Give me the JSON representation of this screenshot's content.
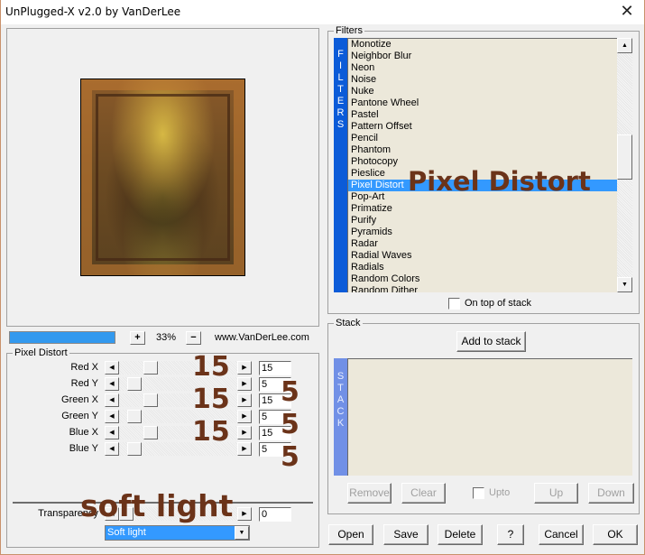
{
  "window": {
    "title": "UnPlugged-X v2.0 by VanDerLee",
    "close_glyph": "✕"
  },
  "preview": {
    "progress_percent": 100,
    "zoom_in_label": "+",
    "zoom_level": "33%",
    "zoom_out_label": "−",
    "website": "www.VanDerLee.com"
  },
  "params": {
    "group_label": "Pixel Distort",
    "sliders": [
      {
        "label": "Red X",
        "value": "15",
        "fraction": 0.15
      },
      {
        "label": "Red Y",
        "value": "5",
        "fraction": 0.05
      },
      {
        "label": "Green X",
        "value": "15",
        "fraction": 0.15
      },
      {
        "label": "Green Y",
        "value": "5",
        "fraction": 0.05
      },
      {
        "label": "Blue X",
        "value": "15",
        "fraction": 0.15
      },
      {
        "label": "Blue Y",
        "value": "5",
        "fraction": 0.05
      }
    ],
    "arrow_left": "◀",
    "arrow_right": "▶",
    "transparency": {
      "label": "Transparency",
      "value": "0",
      "fraction": 0.0
    },
    "blend_mode": {
      "selected": "Soft light",
      "arrow": "▼"
    }
  },
  "overlays": {
    "filter_name": "Pixel Distort",
    "slider_values": [
      "15",
      "5",
      "15",
      "5",
      "15",
      "5"
    ],
    "blend_mode": "soft light"
  },
  "filters": {
    "group_label": "Filters",
    "side_label": [
      "F",
      "I",
      "L",
      "T",
      "E",
      "R",
      "S"
    ],
    "items": [
      "Monotize",
      "Neighbor Blur",
      "Neon",
      "Noise",
      "Nuke",
      "Pantone Wheel",
      "Pastel",
      "Pattern Offset",
      "Pencil",
      "Phantom",
      "Photocopy",
      "Pieslice",
      "Pixel Distort",
      "Pop-Art",
      "Primatize",
      "Purify",
      "Pyramids",
      "Radar",
      "Radial Waves",
      "Radials",
      "Random Colors",
      "Random Dither"
    ],
    "selected_index": 12,
    "scroll_up": "▲",
    "scroll_down": "▼",
    "on_top_label": "On top of stack",
    "on_top_checked": false
  },
  "stack": {
    "group_label": "Stack",
    "side_label": [
      "S",
      "T",
      "A",
      "C",
      "K"
    ],
    "add_label": "Add to stack",
    "remove_label": "Remove",
    "clear_label": "Clear",
    "upto_label": "Upto",
    "up_label": "Up",
    "down_label": "Down"
  },
  "footer": {
    "open": "Open",
    "save": "Save",
    "delete": "Delete",
    "help": "?",
    "cancel": "Cancel",
    "ok": "OK"
  }
}
